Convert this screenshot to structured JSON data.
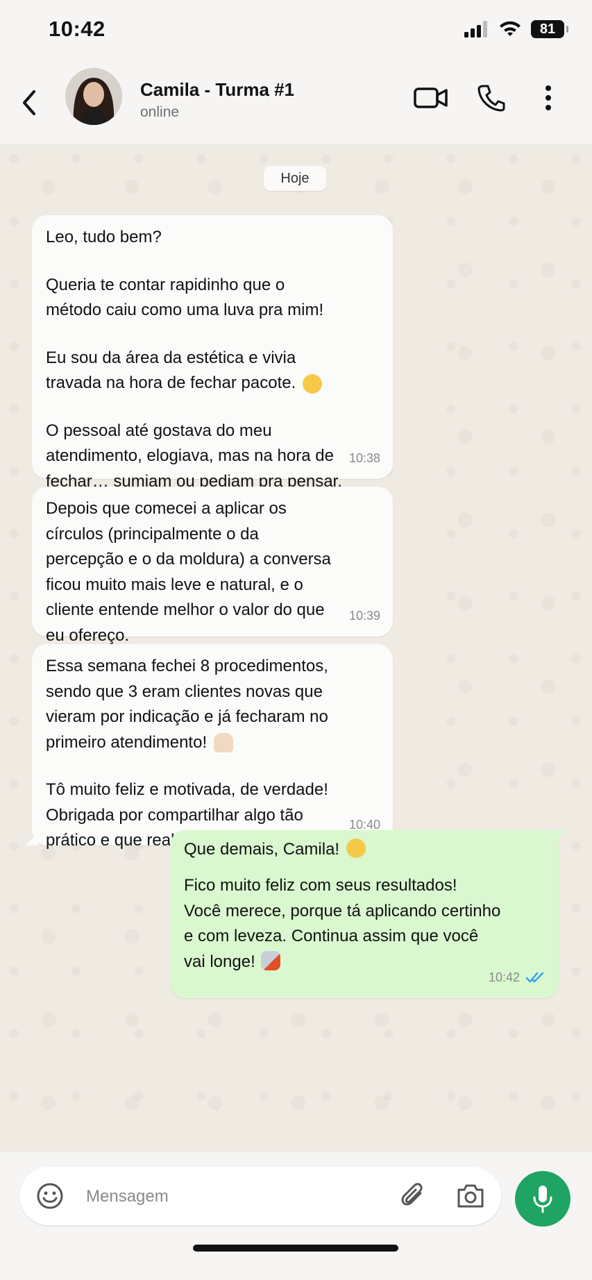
{
  "status_bar": {
    "time": "10:42",
    "battery": "81"
  },
  "header": {
    "contact_name": "Camila - Turma #1",
    "contact_status": "online",
    "icons": [
      "back-icon",
      "video-call-icon",
      "phone-icon",
      "more-vert-icon"
    ]
  },
  "chat": {
    "date_label": "Hoje",
    "messages": [
      {
        "direction": "in",
        "paragraphs": [
          "Leo, tudo bem?",
          "Queria te contar rapidinho que o\nmétodo caiu como uma luva pra mim!",
          "Eu sou da área da estética e vivia\ntravada na hora de fechar pacote.",
          "O pessoal até gostava do meu\natendimento, elogiava, mas na hora de\nfechar… sumiam ou pediam pra pensar."
        ],
        "time": "10:38"
      },
      {
        "direction": "in",
        "paragraphs": [
          "Depois que comecei a aplicar os\ncírculos (principalmente o da\npercepção e o da moldura) a conversa\nficou muito mais leve e natural, e o\ncliente entende melhor o valor do que\neu ofereço."
        ],
        "time": "10:39"
      },
      {
        "direction": "in",
        "paragraphs": [
          "Essa semana fechei 8 procedimentos,\nsendo que 3 eram clientes novas que\nvieram por indicação e já fecharam no\nprimeiro atendimento!",
          "Tô muito feliz e motivada, de verdade!\nObrigada por compartilhar algo tão\nprático e que realmente funciona."
        ],
        "time": "10:40"
      },
      {
        "direction": "out",
        "paragraphs": [
          "Que demais, Camila!",
          "Fico muito feliz com seus resultados!\nVocê merece, porque tá aplicando certinho\ne com leveza. Continua assim que você\nvai longe!"
        ],
        "time": "10:42",
        "read_status": "read"
      }
    ]
  },
  "composer": {
    "placeholder": "Mensagem",
    "value": "",
    "icons": [
      "emoji-icon",
      "attach-icon",
      "camera-icon",
      "mic-icon"
    ],
    "accent_color": "#1fa463"
  }
}
